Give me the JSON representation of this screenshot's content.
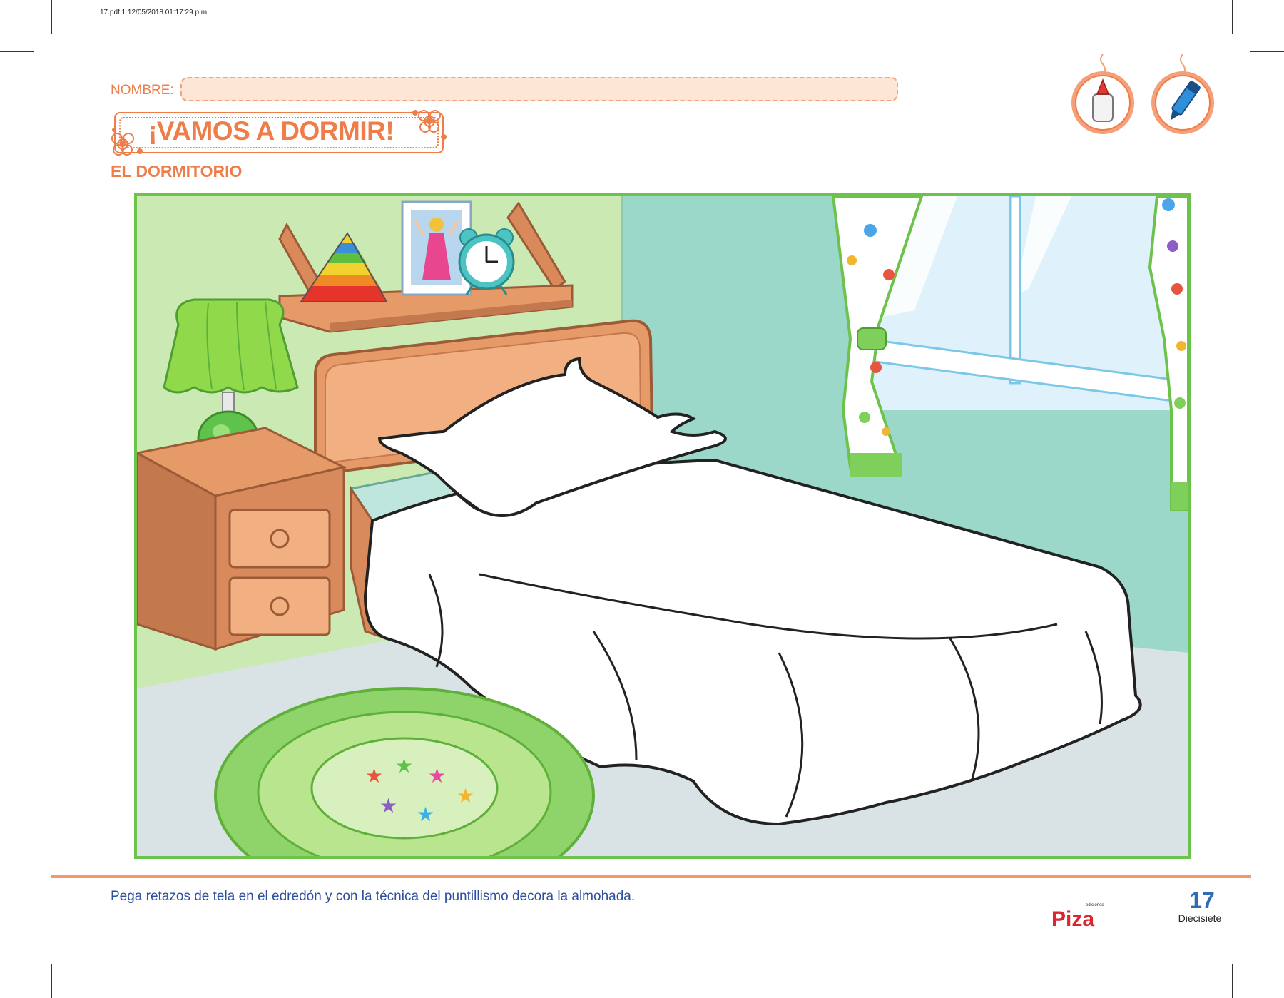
{
  "print_meta": "17.pdf   1   12/05/2018   01:17:29 p.m.",
  "header": {
    "name_label": "NOMBRE:",
    "title": "¡VAMOS A DORMIR!",
    "subtitle": "EL DORMITORIO",
    "material_icons": [
      "glue-bottle-icon",
      "marker-icon"
    ]
  },
  "instruction": "Pega retazos de tela en el edredón y con la técnica del puntillismo decora la almohada.",
  "footer": {
    "logo_small": "ediciones",
    "logo_main": "Piza",
    "page_number": "17",
    "page_word": "Diecisiete"
  },
  "colors": {
    "accent_orange": "#ee7d4a",
    "frame_green": "#6cc24a",
    "instruction_blue": "#2e4f9e",
    "logo_red": "#d9262f"
  }
}
